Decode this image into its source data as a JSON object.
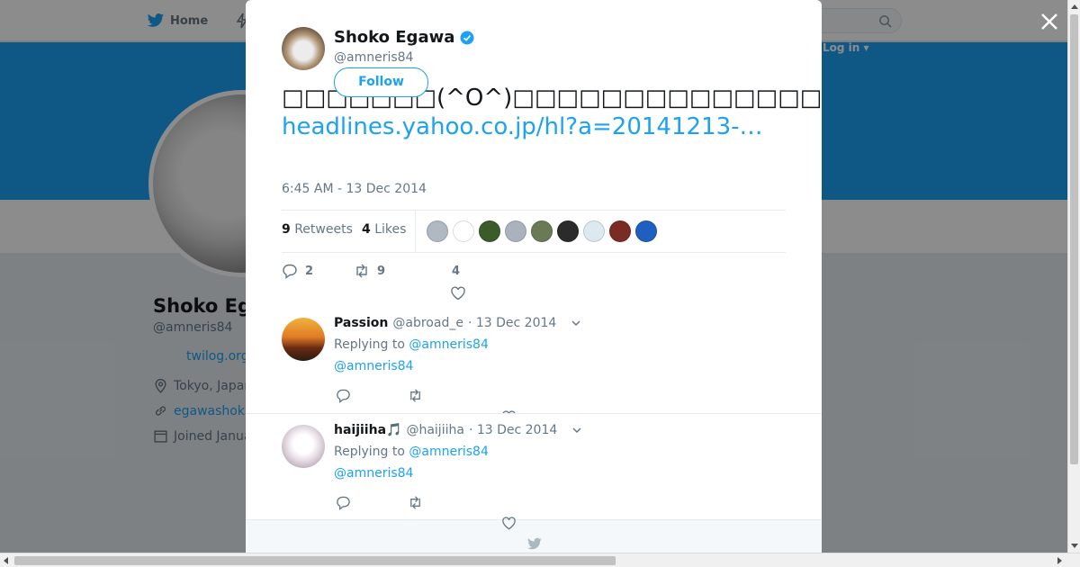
{
  "colors": {
    "brand": "#1da1f2",
    "text": "#14171a",
    "muted": "#657786"
  },
  "nav": {
    "home_label": "Home",
    "login_label": "Log in ▾"
  },
  "profile": {
    "name": "Shoko Eg",
    "handle": "@amneris84",
    "url": "twilog.org",
    "location": "Tokyo, Japan",
    "website": "egawashok",
    "joined": "Joined Janua"
  },
  "tweet": {
    "author_name": "Shoko Egawa",
    "author_handle": "@amneris84",
    "follow_label": "Follow",
    "text": "□□□□□□□(^O^)□□□□□□□□□□□□□□□□□□□□□□□□□□□□□□□□□□□ →□□",
    "link": "headlines.yahoo.co.jp/hl?a=20141213-…",
    "timestamp": "6:45 AM - 13 Dec 2014",
    "retweets_count": "9",
    "retweets_label": "Retweets",
    "likes_count": "4",
    "likes_label": "Likes",
    "reply_count": "2",
    "retweet_count": "9",
    "like_count": "4"
  },
  "likers": [
    "#b0b8c1",
    "#ffffff",
    "#3b5c2a",
    "#aab3bd",
    "#6a7a54",
    "#2b2b2b",
    "#dce9f0",
    "#7a2b24",
    "#1f5fbf"
  ],
  "replies": [
    {
      "name": "Passion",
      "handle": "@abroad_e",
      "date": "· 13 Dec 2014",
      "replying_to_label": "Replying to",
      "replying_to": "@amneris84",
      "body": "@amneris84"
    },
    {
      "name": "haijiiha🎵",
      "handle": "@haijiiha",
      "date": "· 13 Dec 2014",
      "replying_to_label": "Replying to",
      "replying_to": "@amneris84",
      "body": "@amneris84"
    }
  ]
}
